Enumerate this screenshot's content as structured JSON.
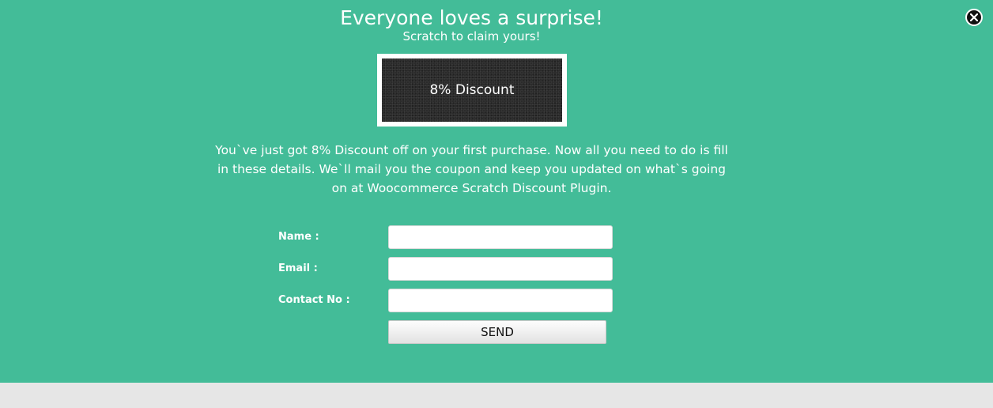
{
  "popup": {
    "title": "Everyone loves a surprise!",
    "subtitle": "Scratch to claim yours!",
    "close_icon": "close-icon",
    "scratch_card": {
      "reveal_text": "8% Discount"
    },
    "message": "You`ve just got 8% Discount off on your first purchase. Now all you need to do is fill in these details. We`ll mail you the coupon and keep you updated on what`s going on at Woocommerce Scratch Discount Plugin.",
    "form": {
      "name_label": "Name :",
      "name_value": "",
      "email_label": "Email :",
      "email_value": "",
      "contact_label": "Contact No :",
      "contact_value": "",
      "send_label": "SEND"
    },
    "colors": {
      "background": "#43bc98",
      "text": "#ffffff",
      "page_bg": "#e6e6e6"
    }
  }
}
